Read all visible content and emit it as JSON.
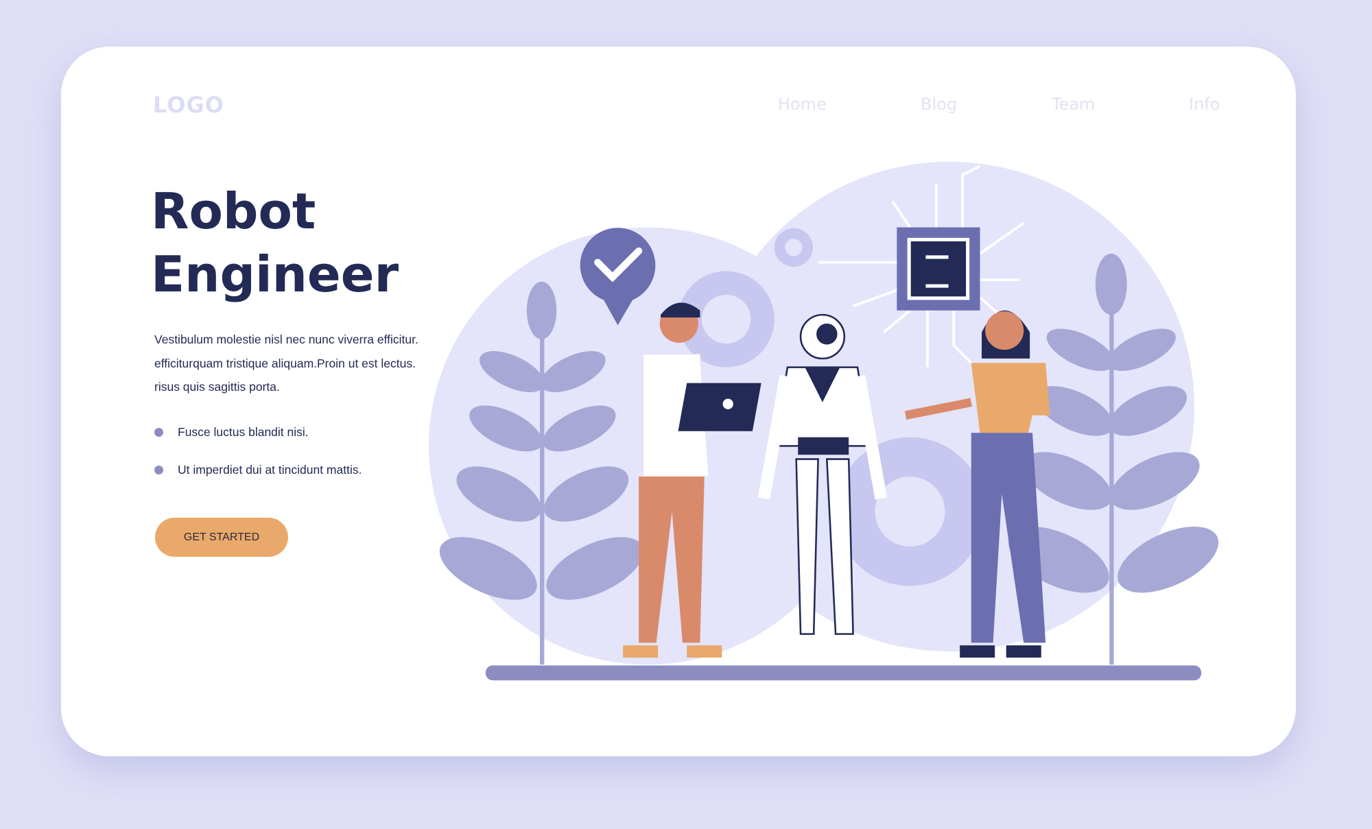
{
  "header": {
    "logo": "LOGO",
    "nav": [
      "Home",
      "Blog",
      "Team",
      "Info"
    ]
  },
  "hero": {
    "title_line1": "Robot",
    "title_line2": "Engineer",
    "paragraph": [
      "Vestibulum molestie nisl nec nunc viverra efficitur.",
      "efficiturquam tristique aliquam.Proin ut est lectus.",
      "risus quis sagittis porta."
    ],
    "bullets": [
      "Fusce luctus blandit nisi.",
      "Ut imperdiet dui at tincidunt mattis."
    ],
    "cta": "GET STARTED"
  },
  "colors": {
    "background": "#dfdff7",
    "title": "#222a55",
    "accent": "#e9a96a",
    "illustration": "#8c8cc0"
  }
}
